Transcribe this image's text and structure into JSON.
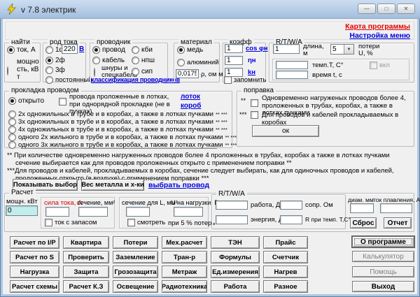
{
  "titlebar": {
    "title": "v 7.8 электрик",
    "min_glyph": "—",
    "max_glyph": "□",
    "close_glyph": "✕"
  },
  "nav": {
    "map_link": "Карта программы",
    "menu_link": "Настройка меню"
  },
  "find": {
    "legend": "найти",
    "opt_current": "ток, А",
    "opt_power": "мощность, кВт"
  },
  "current_kind": {
    "legend": "род тока",
    "opt1": "1ф",
    "voltage": "220",
    "volt_link": "В",
    "opt2": "2ф",
    "opt3": "3ф",
    "opt4": "постоянный"
  },
  "conductor": {
    "legend": "проводник",
    "opt_wire": "провод",
    "opt_cable": "кабель",
    "opt_cords": "шнуры и спецкабель",
    "opt_kbi": "кби",
    "opt_npsh": "нпш",
    "opt_sip": "сип",
    "class_link": "классификация проводников"
  },
  "material": {
    "legend": "материал",
    "opt_copper": "медь",
    "opt_alum": "алюминий",
    "rho_value": "0,0175",
    "rho_label": "ρ, ом м"
  },
  "koeff": {
    "legend": "коэфф",
    "v1": "1",
    "l1": "cos φн",
    "v2": "1",
    "l2": "ηн",
    "v3": "1",
    "l3": "kн",
    "remember": "запомнить"
  },
  "rtwa": {
    "legend": "R/T/W/A",
    "len_value": "1",
    "len_label": "длина, м",
    "loss_value": "5",
    "loss_label": "потери U, %",
    "temp_label": "темп.T, C°",
    "on_label": "вкл",
    "time_label": "время t, с"
  },
  "laying": {
    "legend": "прокладка проводом",
    "open": "открыто",
    "tray_note": "провода проложенные в лотках, при однорядной прокладке (не в пучках)",
    "tray_link": "лоток",
    "duct_link": "короб",
    "marks": "** ***",
    "opt1": "2х одножильных в трубе и в коробах, а также в лотках пучками",
    "opt2": "3х одножильных в трубе и в коробах, а также в лотках пучками",
    "opt3": "4х одножильных в трубе и в коробах, а также в лотках пучками",
    "opt4": "одного 2х жильного в трубе и в коробах, а также в лотках пучками",
    "opt5": "одного 3х жильного в трубе и в коробах, а также в лотках пучками"
  },
  "correction": {
    "legend": "поправка",
    "mark1": "**",
    "text1": "Одновременно нагруженых проводов более 4, проложенных в трубах, коробах, а также в лотках пучками",
    "mark2": "***",
    "text2": "Для проводов и кабелей прокладываемых в коробах",
    "ok": "ок"
  },
  "notes": {
    "note1": "** При количестве одновременно нагруженных проводов более 4 проложенных в трубах, коробах а также в лотках пучками сечение выбирается как для проводов проложенных открыто с применением поправки **",
    "note2": "***Для проводов и кабелей, прокладываемых в коробах, сечение следует выбирать, как для одиночных проводов и кабелей, проложенных открыто (в воздухе) с применением поправки ***"
  },
  "mid": {
    "show_btn": "Показывать выбор",
    "weight_btn": "Вес металла и х-ки",
    "choose_link": "выбрать провод"
  },
  "calc": {
    "legend": "Расчет",
    "power_label": "мощн. кВт",
    "power_value": "0",
    "current_label": "сила тока, А",
    "section_label": "сечение, мм²",
    "reserve": "ток с запасом",
    "sec_l_label": "сечение для L, мм²",
    "u_label": "U на нагрузки, В",
    "watch": "смотреть",
    "loss5": "при 5 % потерь",
    "rtwa_legend": "R/T/W/A",
    "work_label": "работа, Дж",
    "res_label": "сопр. Ом",
    "energy_label": "энергия, Дж",
    "rtemp_label": "R при темп. T,C°",
    "diam_label": "диам. мм",
    "melt_label": "ток плавления, А",
    "reset_btn": "Сброс",
    "report_btn": "Отчет"
  },
  "grid": [
    [
      "Расчет по I/P",
      "Квартира",
      "Потери",
      "Мех.расчет",
      "ТЭН",
      "Прайс"
    ],
    [
      "Расчет по S",
      "Проверить",
      "Заземление",
      "Тран-р",
      "Формулы",
      "Счетчик"
    ],
    [
      "Нагрузка",
      "Защита",
      "Грозозащита",
      "Метраж",
      "Ед.измерения",
      "Нагрев"
    ],
    [
      "Расчет схемы",
      "Расчет К.З",
      "Освещение",
      "Радиотехника",
      "Работа",
      "Разное"
    ]
  ],
  "side": {
    "about": "О программе",
    "calculator": "Калькулятор",
    "help": "Помощь",
    "exit": "Выход"
  },
  "colors": {
    "titlebar": "#B4CBE6",
    "link_blue": "#0000E0",
    "link_red": "#E00000",
    "power_input_bg": "#C2EDED"
  }
}
